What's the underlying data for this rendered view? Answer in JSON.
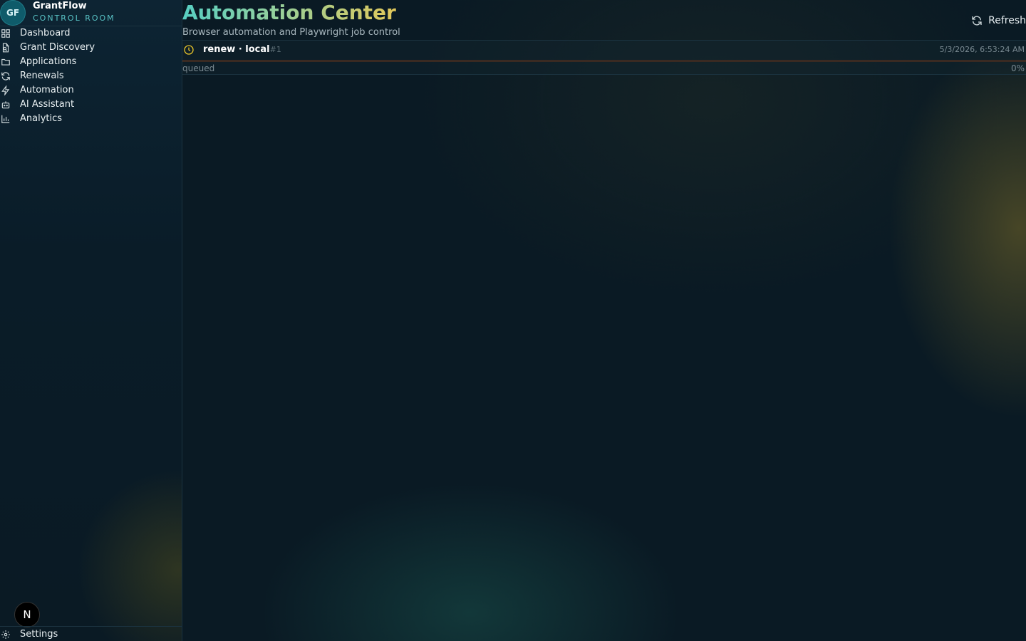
{
  "brand": {
    "logo_text": "GF",
    "name": "GrantFlow",
    "subtitle": "CONTROL ROOM"
  },
  "sidebar": {
    "items": [
      {
        "label": "Dashboard",
        "icon": "grid-icon"
      },
      {
        "label": "Grant Discovery",
        "icon": "file-search-icon"
      },
      {
        "label": "Applications",
        "icon": "folder-icon"
      },
      {
        "label": "Renewals",
        "icon": "refresh-icon"
      },
      {
        "label": "Automation",
        "icon": "zap-icon"
      },
      {
        "label": "AI Assistant",
        "icon": "bot-icon"
      },
      {
        "label": "Analytics",
        "icon": "bar-chart-icon"
      }
    ],
    "avatar_letter": "N",
    "settings_label": "Settings"
  },
  "header": {
    "title": "Automation Center",
    "subtitle": "Browser automation and Playwright job control",
    "refresh_label": "Refresh"
  },
  "jobs": [
    {
      "name": "renew · local",
      "id": "#1",
      "timestamp": "5/3/2026, 6:53:24 AM",
      "status": "queued",
      "progress_label": "0%",
      "progress_fraction": 0,
      "status_icon": "clock-icon"
    }
  ],
  "colors": {
    "accent_teal": "#57cfc2",
    "accent_gold": "#e2c85a",
    "status_queued": "#e6c229",
    "progress": "#e09a3a"
  }
}
